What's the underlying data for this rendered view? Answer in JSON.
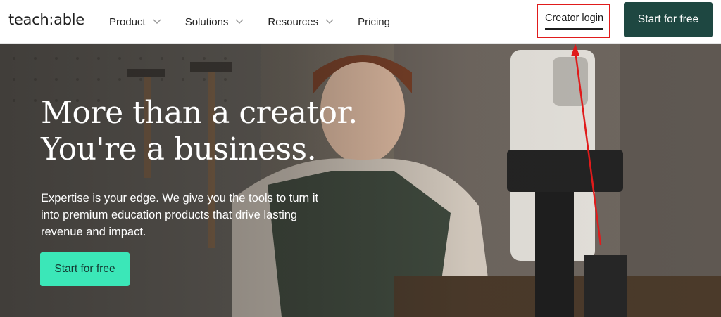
{
  "header": {
    "logo": "teach:able",
    "nav": [
      {
        "label": "Product",
        "has_dropdown": true
      },
      {
        "label": "Solutions",
        "has_dropdown": true
      },
      {
        "label": "Resources",
        "has_dropdown": true
      },
      {
        "label": "Pricing",
        "has_dropdown": false
      }
    ],
    "login_label": "Creator login",
    "cta_label": "Start for free"
  },
  "hero": {
    "headline_line1": "More than a creator.",
    "headline_line2": "You're a business.",
    "subtext": "Expertise is your edge. We give you the tools to turn it into premium education products that drive lasting revenue and impact.",
    "cta_label": "Start for free"
  },
  "annotation": {
    "highlight_color": "#e01b1b",
    "arrow_color": "#e01b1b"
  },
  "colors": {
    "header_cta_bg": "#1e4741",
    "hero_cta_bg": "#3be7b8",
    "hero_cta_text": "#143a33"
  }
}
